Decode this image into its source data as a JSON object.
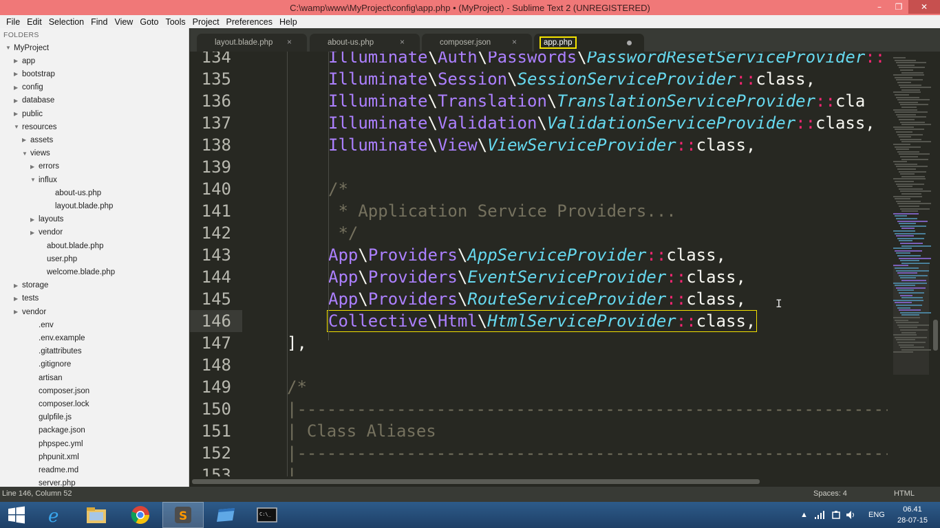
{
  "window": {
    "title": "C:\\wamp\\www\\MyProject\\config\\app.php • (MyProject) - Sublime Text 2 (UNREGISTERED)",
    "min_glyph": "–",
    "max_glyph": "❐",
    "close_glyph": "✕"
  },
  "menu": [
    "File",
    "Edit",
    "Selection",
    "Find",
    "View",
    "Goto",
    "Tools",
    "Project",
    "Preferences",
    "Help"
  ],
  "sidebar": {
    "header": "FOLDERS",
    "items": [
      {
        "label": "MyProject",
        "depth": 0,
        "arrow": "▼"
      },
      {
        "label": "app",
        "depth": 1,
        "arrow": "▶"
      },
      {
        "label": "bootstrap",
        "depth": 1,
        "arrow": "▶"
      },
      {
        "label": "config",
        "depth": 1,
        "arrow": "▶"
      },
      {
        "label": "database",
        "depth": 1,
        "arrow": "▶"
      },
      {
        "label": "public",
        "depth": 1,
        "arrow": "▶"
      },
      {
        "label": "resources",
        "depth": 1,
        "arrow": "▼"
      },
      {
        "label": "assets",
        "depth": 2,
        "arrow": "▶"
      },
      {
        "label": "views",
        "depth": 2,
        "arrow": "▼"
      },
      {
        "label": "errors",
        "depth": 3,
        "arrow": "▶"
      },
      {
        "label": "influx",
        "depth": 3,
        "arrow": "▼"
      },
      {
        "label": "about-us.php",
        "depth": 4,
        "arrow": ""
      },
      {
        "label": "layout.blade.php",
        "depth": 4,
        "arrow": ""
      },
      {
        "label": "layouts",
        "depth": 3,
        "arrow": "▶"
      },
      {
        "label": "vendor",
        "depth": 3,
        "arrow": "▶"
      },
      {
        "label": "about.blade.php",
        "depth": 3,
        "arrow": ""
      },
      {
        "label": "user.php",
        "depth": 3,
        "arrow": ""
      },
      {
        "label": "welcome.blade.php",
        "depth": 3,
        "arrow": ""
      },
      {
        "label": "storage",
        "depth": 1,
        "arrow": "▶"
      },
      {
        "label": "tests",
        "depth": 1,
        "arrow": "▶"
      },
      {
        "label": "vendor",
        "depth": 1,
        "arrow": "▶"
      },
      {
        "label": ".env",
        "depth": 2,
        "arrow": ""
      },
      {
        "label": ".env.example",
        "depth": 2,
        "arrow": ""
      },
      {
        "label": ".gitattributes",
        "depth": 2,
        "arrow": ""
      },
      {
        "label": ".gitignore",
        "depth": 2,
        "arrow": ""
      },
      {
        "label": "artisan",
        "depth": 2,
        "arrow": ""
      },
      {
        "label": "composer.json",
        "depth": 2,
        "arrow": ""
      },
      {
        "label": "composer.lock",
        "depth": 2,
        "arrow": ""
      },
      {
        "label": "gulpfile.js",
        "depth": 2,
        "arrow": ""
      },
      {
        "label": "package.json",
        "depth": 2,
        "arrow": ""
      },
      {
        "label": "phpspec.yml",
        "depth": 2,
        "arrow": ""
      },
      {
        "label": "phpunit.xml",
        "depth": 2,
        "arrow": ""
      },
      {
        "label": "readme.md",
        "depth": 2,
        "arrow": ""
      },
      {
        "label": "server.php",
        "depth": 2,
        "arrow": ""
      }
    ]
  },
  "tabs": [
    {
      "label": "layout.blade.php",
      "active": false,
      "dirty": false
    },
    {
      "label": "about-us.php",
      "active": false,
      "dirty": false
    },
    {
      "label": "composer.json",
      "active": false,
      "dirty": false
    },
    {
      "label": "app.php",
      "active": true,
      "dirty": true
    }
  ],
  "tab_close_glyph": "×",
  "editor": {
    "current_line": "146",
    "lines": [
      {
        "n": "134",
        "tokens": [
          [
            "ns",
            "Illuminate"
          ],
          [
            "sep",
            "\\"
          ],
          [
            "ns",
            "Auth"
          ],
          [
            "sep",
            "\\"
          ],
          [
            "ns",
            "Passwords"
          ],
          [
            "sep",
            "\\"
          ],
          [
            "cls",
            "PasswordResetServiceProvider"
          ],
          [
            "op",
            "::"
          ]
        ],
        "indent": 8
      },
      {
        "n": "135",
        "tokens": [
          [
            "ns",
            "Illuminate"
          ],
          [
            "sep",
            "\\"
          ],
          [
            "ns",
            "Session"
          ],
          [
            "sep",
            "\\"
          ],
          [
            "cls",
            "SessionServiceProvider"
          ],
          [
            "op",
            "::"
          ],
          [
            "kw",
            "class,"
          ]
        ],
        "indent": 8
      },
      {
        "n": "136",
        "tokens": [
          [
            "ns",
            "Illuminate"
          ],
          [
            "sep",
            "\\"
          ],
          [
            "ns",
            "Translation"
          ],
          [
            "sep",
            "\\"
          ],
          [
            "cls",
            "TranslationServiceProvider"
          ],
          [
            "op",
            "::"
          ],
          [
            "kw",
            "cla"
          ]
        ],
        "indent": 8
      },
      {
        "n": "137",
        "tokens": [
          [
            "ns",
            "Illuminate"
          ],
          [
            "sep",
            "\\"
          ],
          [
            "ns",
            "Validation"
          ],
          [
            "sep",
            "\\"
          ],
          [
            "cls",
            "ValidationServiceProvider"
          ],
          [
            "op",
            "::"
          ],
          [
            "kw",
            "class,"
          ]
        ],
        "indent": 8
      },
      {
        "n": "138",
        "tokens": [
          [
            "ns",
            "Illuminate"
          ],
          [
            "sep",
            "\\"
          ],
          [
            "ns",
            "View"
          ],
          [
            "sep",
            "\\"
          ],
          [
            "cls",
            "ViewServiceProvider"
          ],
          [
            "op",
            "::"
          ],
          [
            "kw",
            "class,"
          ]
        ],
        "indent": 8
      },
      {
        "n": "139",
        "tokens": [],
        "indent": 0
      },
      {
        "n": "140",
        "tokens": [
          [
            "cmt",
            "/*"
          ]
        ],
        "indent": 8
      },
      {
        "n": "141",
        "tokens": [
          [
            "cmt",
            " * Application Service Providers..."
          ]
        ],
        "indent": 8
      },
      {
        "n": "142",
        "tokens": [
          [
            "cmt",
            " */"
          ]
        ],
        "indent": 8
      },
      {
        "n": "143",
        "tokens": [
          [
            "ns",
            "App"
          ],
          [
            "sep",
            "\\"
          ],
          [
            "ns",
            "Providers"
          ],
          [
            "sep",
            "\\"
          ],
          [
            "cls",
            "AppServiceProvider"
          ],
          [
            "op",
            "::"
          ],
          [
            "kw",
            "class,"
          ]
        ],
        "indent": 8
      },
      {
        "n": "144",
        "tokens": [
          [
            "ns",
            "App"
          ],
          [
            "sep",
            "\\"
          ],
          [
            "ns",
            "Providers"
          ],
          [
            "sep",
            "\\"
          ],
          [
            "cls",
            "EventServiceProvider"
          ],
          [
            "op",
            "::"
          ],
          [
            "kw",
            "class,"
          ]
        ],
        "indent": 8
      },
      {
        "n": "145",
        "tokens": [
          [
            "ns",
            "App"
          ],
          [
            "sep",
            "\\"
          ],
          [
            "ns",
            "Providers"
          ],
          [
            "sep",
            "\\"
          ],
          [
            "cls",
            "RouteServiceProvider"
          ],
          [
            "op",
            "::"
          ],
          [
            "kw",
            "class,"
          ]
        ],
        "indent": 8
      },
      {
        "n": "146",
        "tokens": [
          [
            "ns",
            "Collective"
          ],
          [
            "sep",
            "\\"
          ],
          [
            "ns",
            "Html"
          ],
          [
            "sep",
            "\\"
          ],
          [
            "cls",
            "HtmlServiceProvider"
          ],
          [
            "op",
            "::"
          ],
          [
            "kw",
            "class,"
          ]
        ],
        "indent": 8,
        "highlight": true
      },
      {
        "n": "147",
        "tokens": [
          [
            "kw",
            "],"
          ]
        ],
        "indent": 4
      },
      {
        "n": "148",
        "tokens": [],
        "indent": 0
      },
      {
        "n": "149",
        "tokens": [
          [
            "cmt",
            "/*"
          ]
        ],
        "indent": 4
      },
      {
        "n": "150",
        "tokens": [
          [
            "cmt",
            "|-------------------------------------------------------------------"
          ]
        ],
        "indent": 4
      },
      {
        "n": "151",
        "tokens": [
          [
            "cmt",
            "| Class Aliases"
          ]
        ],
        "indent": 4
      },
      {
        "n": "152",
        "tokens": [
          [
            "cmt",
            "|-------------------------------------------------------------------"
          ]
        ],
        "indent": 4
      },
      {
        "n": "153",
        "tokens": [
          [
            "cmt",
            "|"
          ]
        ],
        "indent": 4
      }
    ]
  },
  "status": {
    "position": "Line 146, Column 52",
    "spaces": "Spaces: 4",
    "syntax": "HTML"
  },
  "taskbar": {
    "lang": "ENG",
    "time": "06.41",
    "date": "28-07-15",
    "tray_arrow": "▲"
  }
}
